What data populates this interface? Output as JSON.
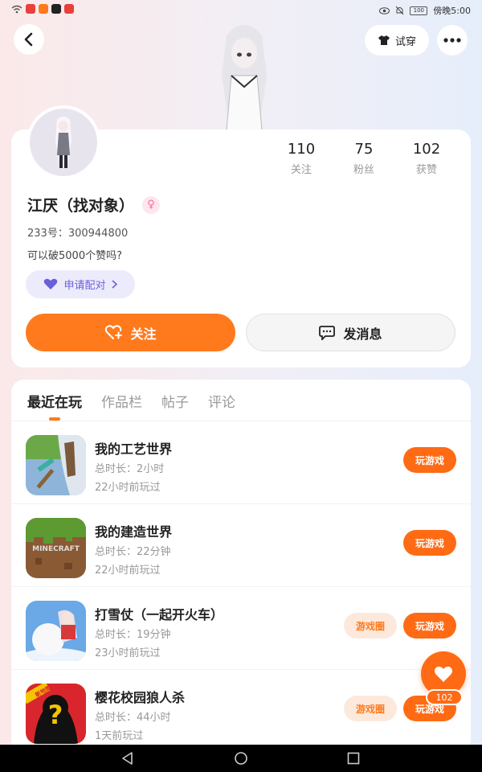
{
  "status_bar": {
    "time": "傍晚5:00",
    "battery": "100"
  },
  "header": {
    "try_on_label": "试穿"
  },
  "profile": {
    "stats": [
      {
        "value": "110",
        "label": "关注"
      },
      {
        "value": "75",
        "label": "粉丝"
      },
      {
        "value": "102",
        "label": "获赞"
      }
    ],
    "name": "江厌（找对象）",
    "gender_symbol": "♀",
    "uid": "233号：300944800",
    "bio": "可以破5000个赞吗?",
    "match_label": "申请配对",
    "follow_label": "关注",
    "message_label": "发消息"
  },
  "tabs": [
    {
      "label": "最近在玩",
      "active": true
    },
    {
      "label": "作品栏",
      "active": false
    },
    {
      "label": "帖子",
      "active": false
    },
    {
      "label": "评论",
      "active": false
    }
  ],
  "games": [
    {
      "title": "我的工艺世界",
      "duration": "总时长：2小时",
      "last_played": "22小时前玩过",
      "play_label": "玩游戏",
      "icon": "pickaxe-game-icon"
    },
    {
      "title": "我的建造世界",
      "duration": "总时长：22分钟",
      "last_played": "22小时前玩过",
      "play_label": "玩游戏",
      "icon": "minecraft-icon",
      "icon_text": "MINECRAFT"
    },
    {
      "title": "打雪仗（一起开火车）",
      "duration": "总时长：19分钟",
      "last_played": "23小时前玩过",
      "play_label": "玩游戏",
      "circle_label": "游戏圈",
      "icon": "snowball-game-icon"
    },
    {
      "title": "樱花校园狼人杀",
      "duration": "总时长：44小时",
      "last_played": "1天前玩过",
      "play_label": "玩游戏",
      "circle_label": "游戏圈",
      "icon": "werewolf-game-icon",
      "icon_badge": "新地图"
    }
  ],
  "like_fab": {
    "count": "102"
  },
  "colors": {
    "accent": "#ff7a1c",
    "match": "#6a5fd8"
  }
}
